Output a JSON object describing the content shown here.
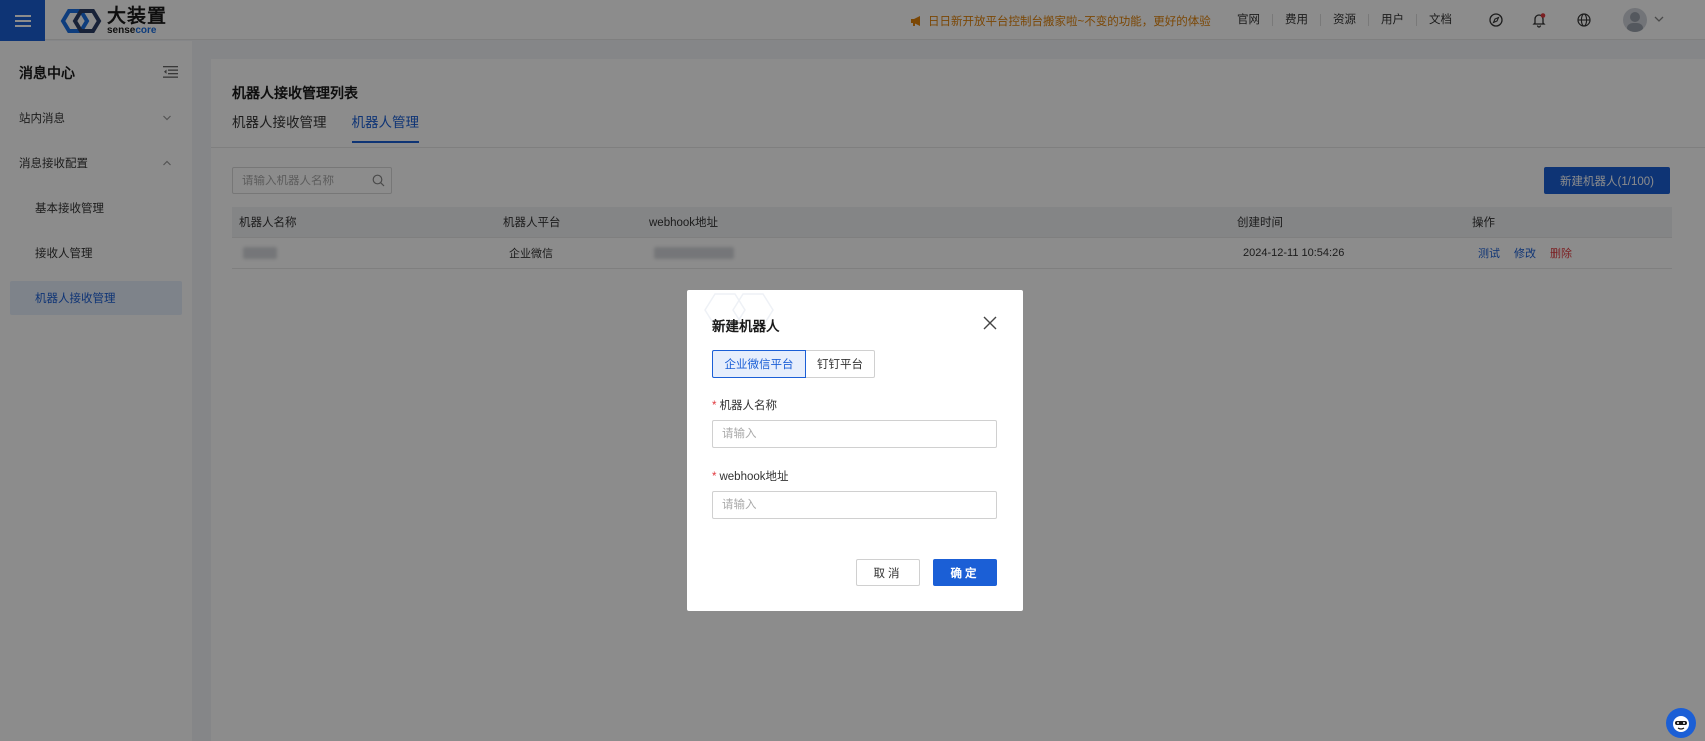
{
  "topbar": {
    "logo_cn": "大装置",
    "logo_en_prefix": "sense",
    "logo_en_suffix": "core",
    "announcement": "日日新开放平台控制台搬家啦~不变的功能，更好的体验",
    "nav": [
      "官网",
      "费用",
      "资源",
      "用户",
      "文档"
    ]
  },
  "sidebar": {
    "title": "消息中心",
    "items": [
      {
        "label": "站内消息"
      },
      {
        "label": "消息接收配置"
      },
      {
        "label": "基本接收管理"
      },
      {
        "label": "接收人管理"
      },
      {
        "label": "机器人接收管理"
      }
    ]
  },
  "main": {
    "title": "机器人接收管理列表",
    "tabs": [
      "机器人接收管理",
      "机器人管理"
    ],
    "search_placeholder": "请输入机器人名称",
    "new_button": "新建机器人(1/100)",
    "columns": [
      "机器人名称",
      "机器人平台",
      "webhook地址",
      "创建时间",
      "操作"
    ],
    "rows": [
      {
        "platform": "企业微信",
        "created": "2024-12-11 10:54:26",
        "actions": [
          "测试",
          "修改",
          "删除"
        ]
      }
    ]
  },
  "modal": {
    "title": "新建机器人",
    "platforms": [
      "企业微信平台",
      "钉钉平台"
    ],
    "fields": [
      {
        "label": "机器人名称",
        "placeholder": "请输入"
      },
      {
        "label": "webhook地址",
        "placeholder": "请输入"
      }
    ],
    "cancel": "取消",
    "ok": "确定"
  },
  "colors": {
    "accent": "#1b5fd6",
    "danger": "#e0393e",
    "announce": "#e0820a"
  }
}
